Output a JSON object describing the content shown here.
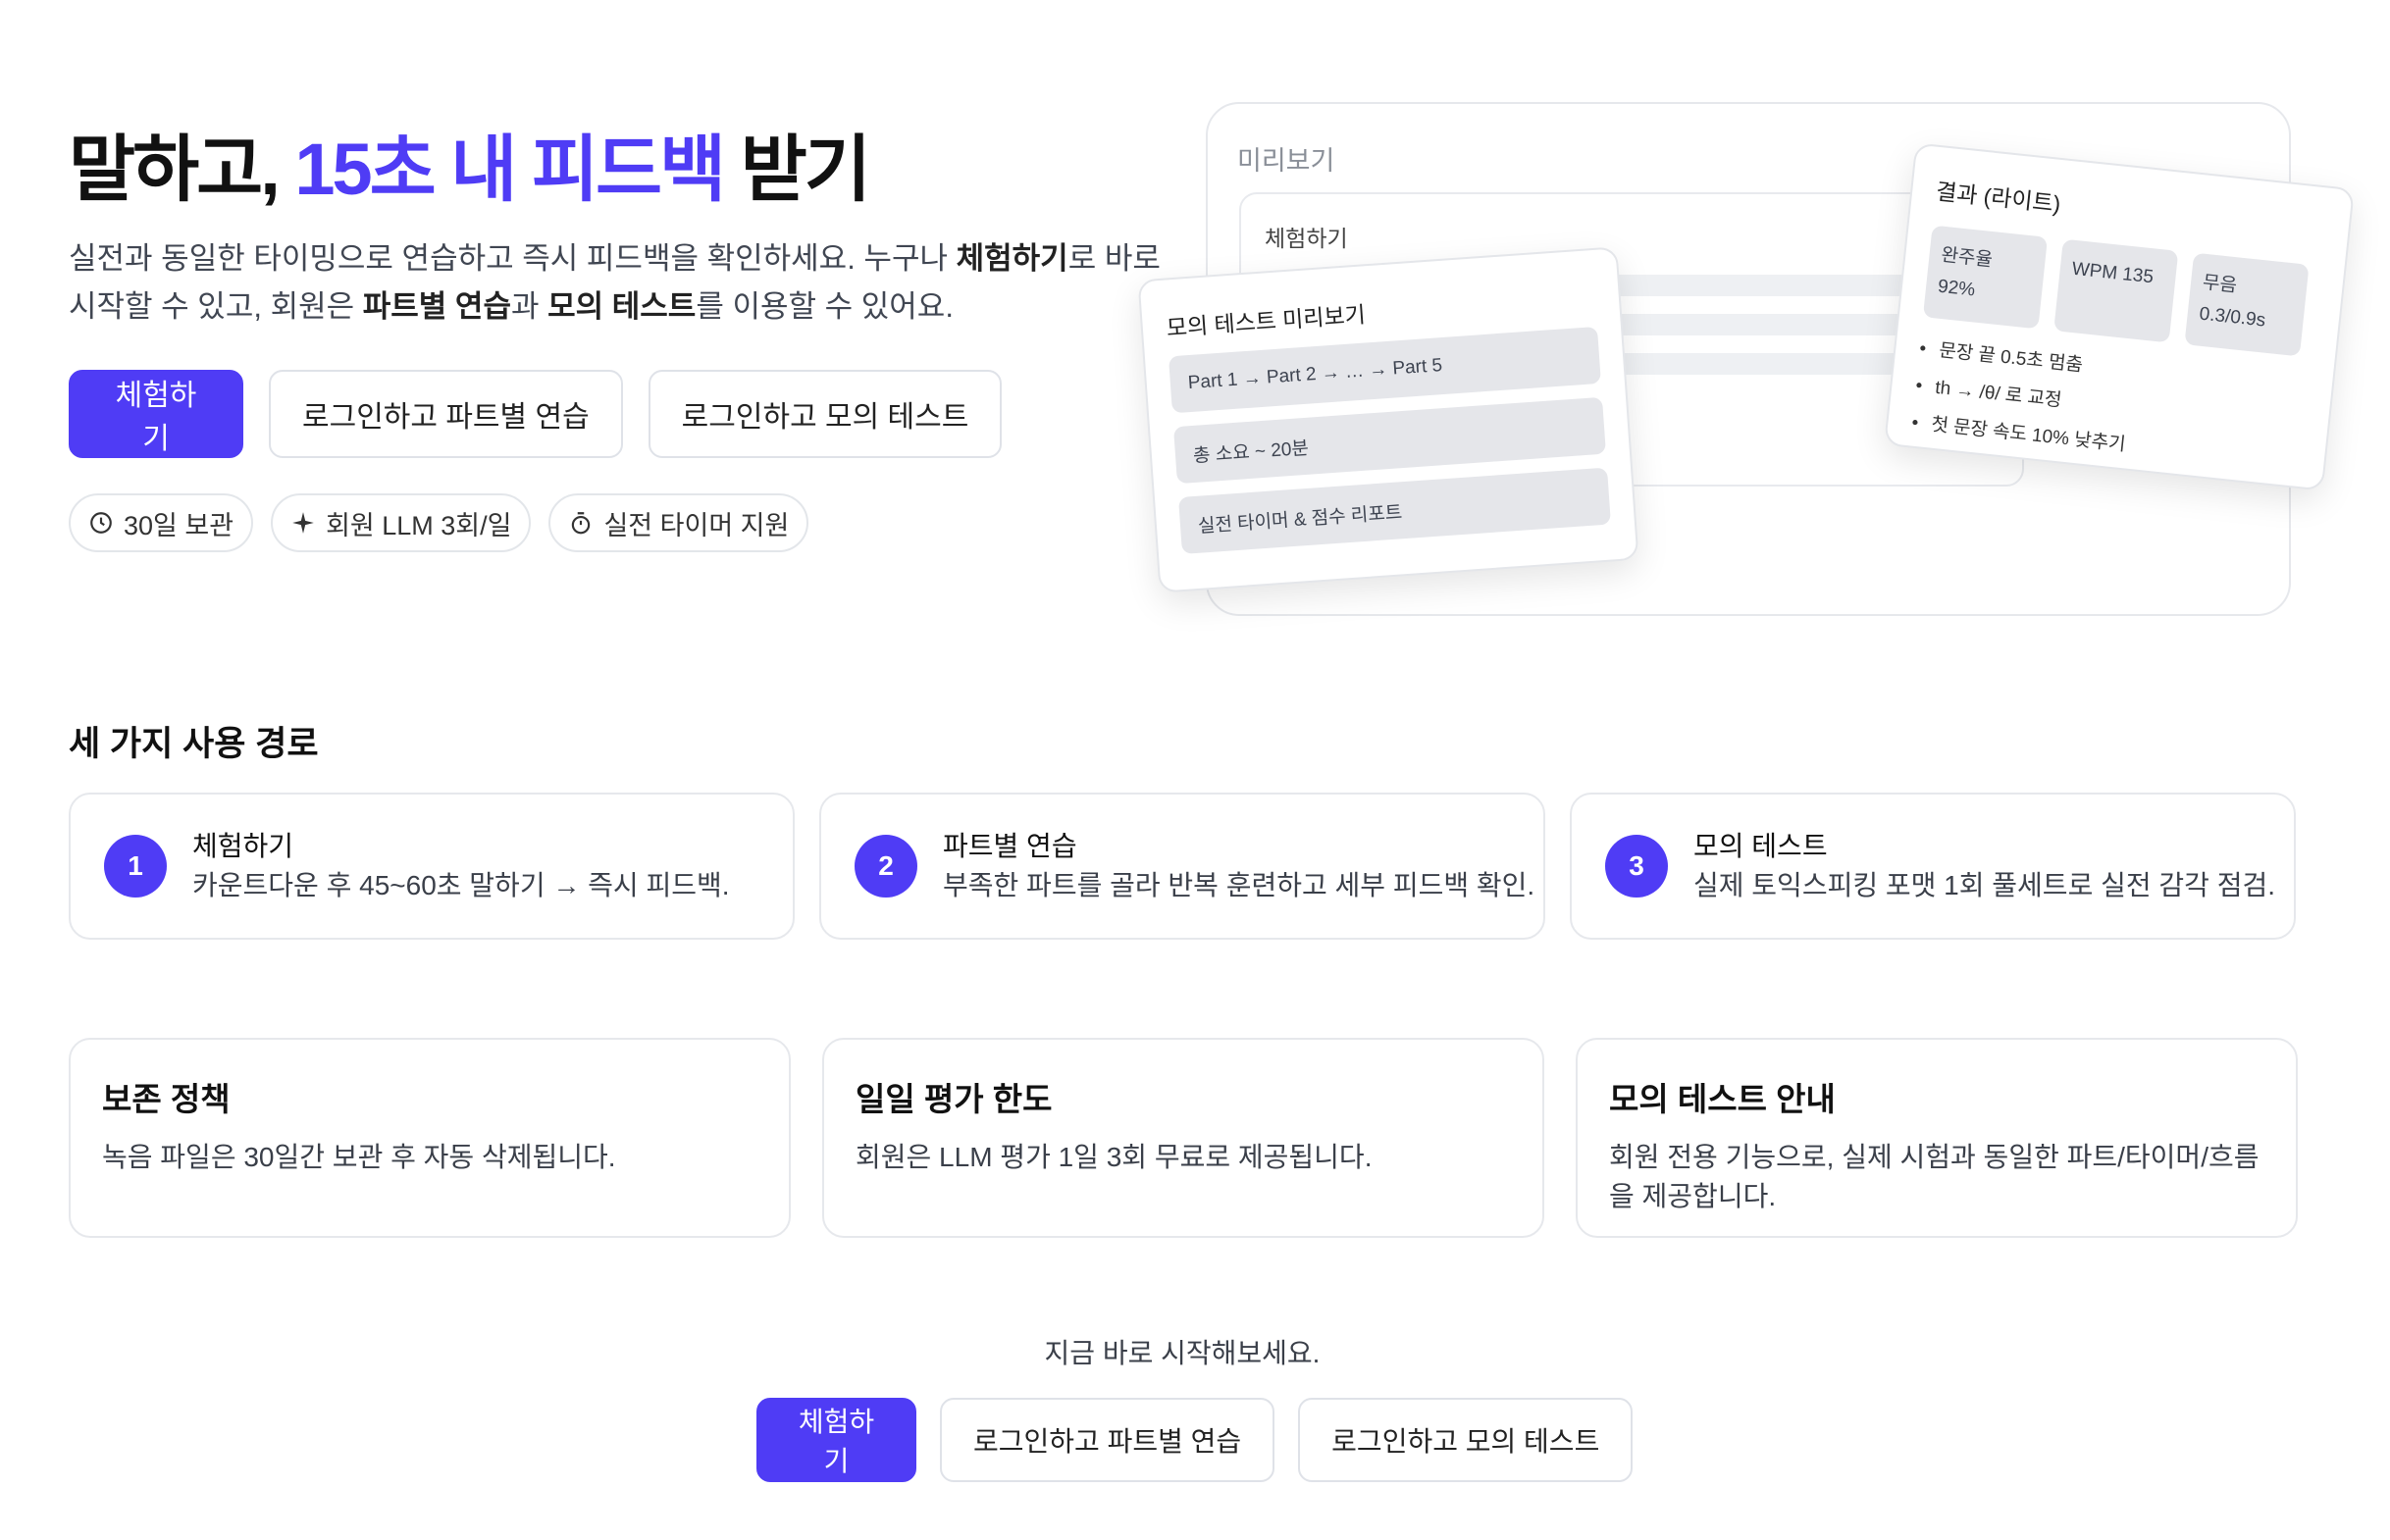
{
  "hero": {
    "title_prefix": "말하고, ",
    "title_accent": "15초 내 피드백",
    "title_suffix": " 받기",
    "desc_1": "실전과 동일한 타이밍으로 연습하고 즉시 피드백을 확인하세요. 누구나 ",
    "desc_bold_1": "체험하기",
    "desc_2": "로 바로 시작할 수 있고, 회원은 ",
    "desc_bold_2": "파트별 연습",
    "desc_3": "과 ",
    "desc_bold_3": "모의 테스트",
    "desc_4": "를 이용할 수 있어요.",
    "buttons": {
      "trial": "체험하기",
      "part_practice": "로그인하고 파트별 연습",
      "mock_test": "로그인하고 모의 테스트"
    },
    "chips": [
      {
        "icon": "clock-icon",
        "label": "30일 보관"
      },
      {
        "icon": "sparkle-icon",
        "label": "회원 LLM 3회/일"
      },
      {
        "icon": "stopwatch-icon",
        "label": "실전 타이머 지원"
      }
    ]
  },
  "preview": {
    "label": "미리보기",
    "inner_title": "체험하기",
    "mock_card": {
      "title": "모의 테스트 미리보기",
      "rows": [
        "Part 1 → Part 2 → … → Part 5",
        "총 소요 ~ 20분",
        "실전 타이머 & 점수 리포트"
      ]
    },
    "result_card": {
      "title": "결과 (라이트)",
      "metrics": [
        {
          "line1": "완주율",
          "line2": "92%"
        },
        {
          "line1": "WPM 135",
          "line2": ""
        },
        {
          "line1": "무음",
          "line2": "0.3/0.9s"
        }
      ],
      "tips": [
        "문장 끝 0.5초 멈춤",
        "th → /θ/ 로 교정",
        "첫 문장 속도 10% 낮추기"
      ]
    }
  },
  "paths": {
    "title": "세 가지 사용 경로",
    "items": [
      {
        "num": "1",
        "title": "체험하기",
        "desc": "카운트다운 후 45~60초 말하기 → 즉시 피드백."
      },
      {
        "num": "2",
        "title": "파트별 연습",
        "desc": "부족한 파트를 골라 반복 훈련하고 세부 피드백 확인."
      },
      {
        "num": "3",
        "title": "모의 테스트",
        "desc": "실제 토익스피킹 포맷 1회 풀세트로 실전 감각 점검."
      }
    ]
  },
  "info": [
    {
      "title": "보존 정책",
      "desc": "녹음 파일은 30일간 보관 후 자동 삭제됩니다."
    },
    {
      "title": "일일 평가 한도",
      "desc": "회원은 LLM 평가 1일 3회 무료로 제공됩니다."
    },
    {
      "title": "모의 테스트 안내",
      "desc": "회원 전용 기능으로, 실제 시험과 동일한 파트/타이머/흐름을 제공합니다."
    }
  ],
  "cta": {
    "text": "지금 바로 시작해보세요.",
    "trial": "체험하기",
    "part_practice": "로그인하고 파트별 연습",
    "mock_test": "로그인하고 모의 테스트"
  },
  "colors": {
    "accent": "#4f3cf5"
  }
}
